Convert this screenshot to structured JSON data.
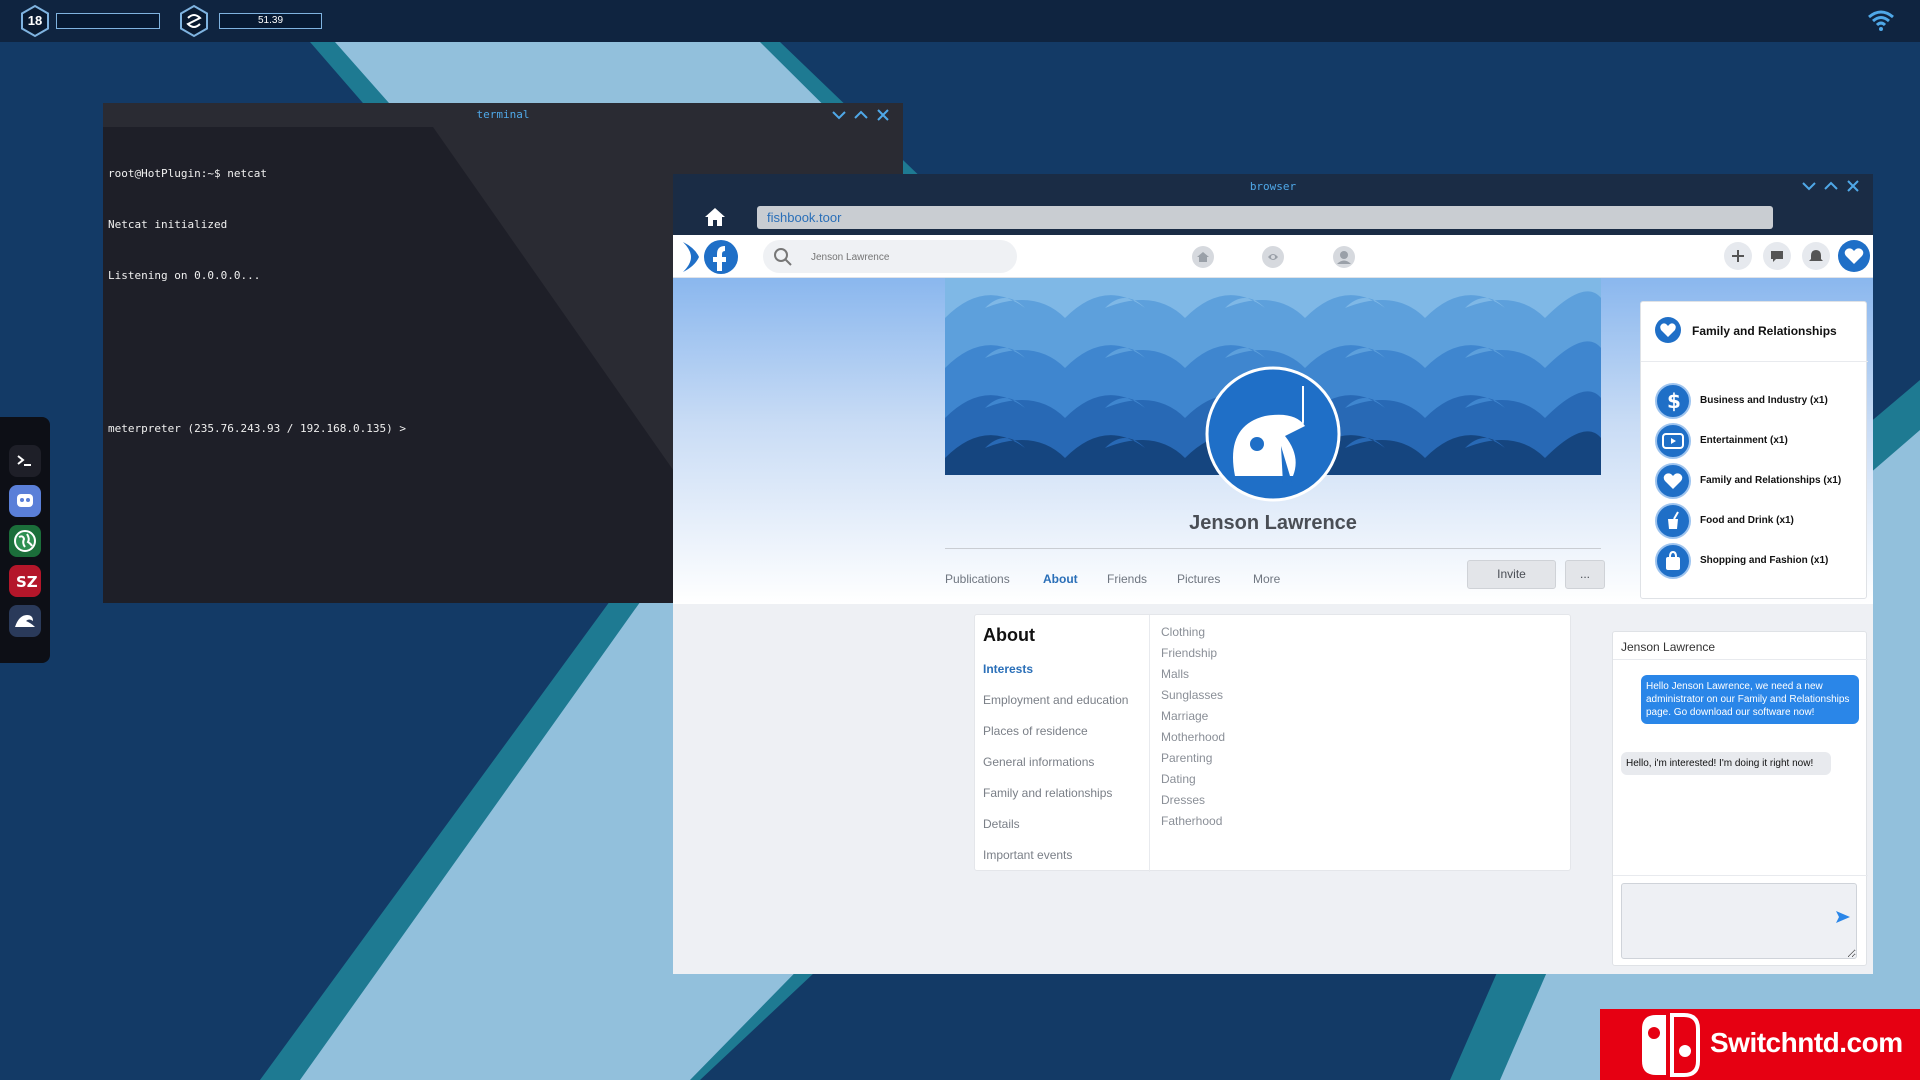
{
  "topbar": {
    "level": "18",
    "money": "51.39"
  },
  "terminal": {
    "title": "terminal",
    "lines": [
      "root@HotPlugin:~$ netcat",
      "Netcat initialized",
      "Listening on 0.0.0.0...",
      "",
      "",
      "meterpreter (235.76.243.93 / 192.168.0.135) >"
    ]
  },
  "browser": {
    "title": "browser",
    "url": "fishbook.toor",
    "search_placeholder": "Jenson Lawrence"
  },
  "profile": {
    "name": "Jenson Lawrence",
    "tabs": [
      "Publications",
      "About",
      "Friends",
      "Pictures",
      "More"
    ],
    "active_tab": "About",
    "invite_label": "Invite",
    "more_label": "..."
  },
  "about": {
    "title": "About",
    "menu": [
      "Interests",
      "Employment and education",
      "Places of residence",
      "General informations",
      "Family and relationships",
      "Details",
      "Important events"
    ],
    "interests": [
      "Clothing",
      "Friendship",
      "Malls",
      "Sunglasses",
      "Marriage",
      "Motherhood",
      "Parenting",
      "Dating",
      "Dresses",
      "Fatherhood"
    ]
  },
  "interests_panel": {
    "header": "Family and Relationships",
    "items": [
      {
        "label": "Business and Industry (x1)",
        "icon": "dollar-icon"
      },
      {
        "label": "Entertainment (x1)",
        "icon": "play-icon"
      },
      {
        "label": "Family and Relationships (x1)",
        "icon": "heart-icon"
      },
      {
        "label": "Food and Drink (x1)",
        "icon": "drink-icon"
      },
      {
        "label": "Shopping and Fashion (x1)",
        "icon": "shopping-bag-icon"
      }
    ]
  },
  "chat": {
    "contact": "Jenson Lawrence",
    "messages": [
      {
        "from": "me",
        "text": "Hello Jenson Lawrence, we need a new administrator on our Family and Relationships page. Go download our software now!"
      },
      {
        "from": "them",
        "text": "Hello, i'm interested! I'm doing it right now!"
      }
    ]
  },
  "watermark": {
    "text": "Switchntd.com"
  },
  "colors": {
    "accent": "#2a86e8",
    "background": "#133a66",
    "watermark": "#e60012"
  }
}
